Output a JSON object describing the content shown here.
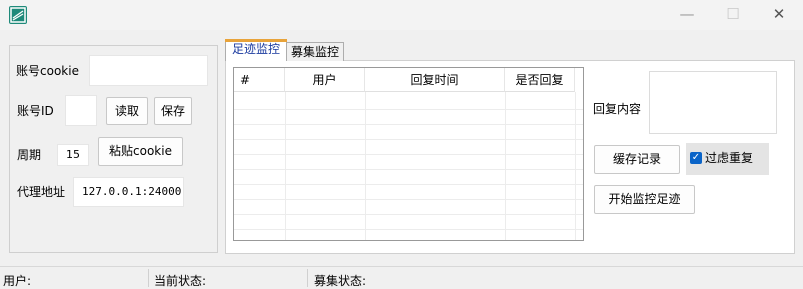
{
  "window": {
    "minimize_glyph": "—",
    "maximize_glyph": "☐",
    "close_glyph": "✕"
  },
  "settings": {
    "account_cookie_label": "账号cookie",
    "account_cookie_value": "",
    "account_id_label": "账号ID",
    "account_id_value": "",
    "read_button": "读取",
    "save_button": "保存",
    "period_label": "周期",
    "period_value": "15",
    "paste_cookie_button": "粘贴cookie",
    "proxy_label": "代理地址",
    "proxy_value": "127.0.0.1:24000"
  },
  "tabs": [
    {
      "label": "足迹监控",
      "active": true
    },
    {
      "label": "募集监控",
      "active": false
    }
  ],
  "table": {
    "columns": [
      "#",
      "用户",
      "回复时间",
      "是否回复"
    ],
    "rows": []
  },
  "reply": {
    "content_label": "回复内容",
    "content_value": "",
    "cache_button": "缓存记录",
    "filter_duplicate_label": "过虑重复",
    "filter_duplicate_checked": true,
    "checkmark": "✓",
    "start_button": "开始监控足迹"
  },
  "statusbar": {
    "user_label": "用户:",
    "current_state_label": "当前状态:",
    "recruit_state_label": "募集状态:"
  }
}
